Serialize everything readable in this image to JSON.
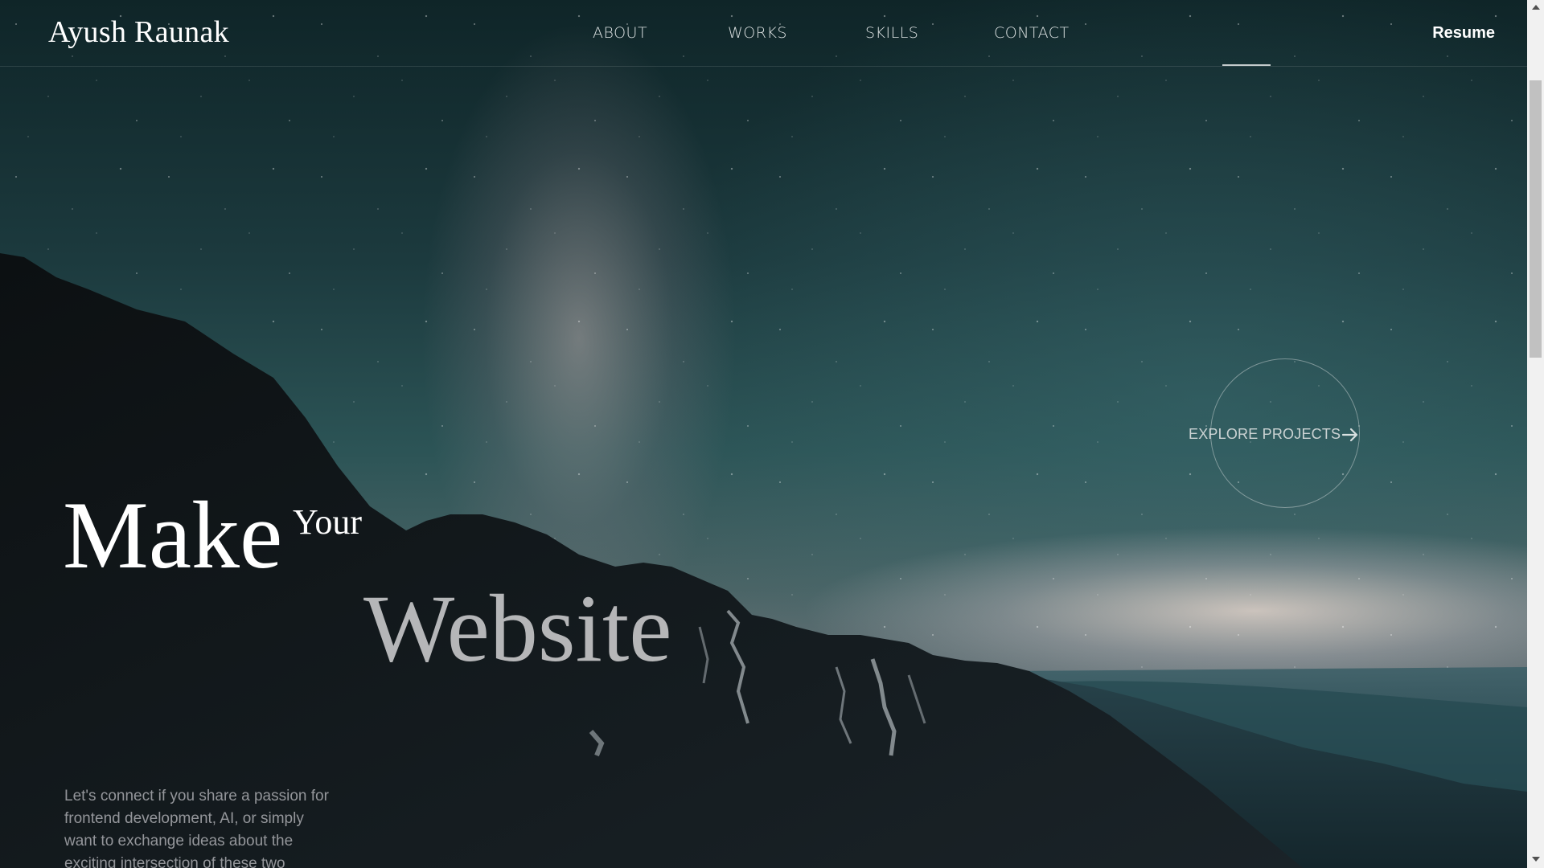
{
  "header": {
    "brand": "Ayush Raunak",
    "nav": [
      "ABOUT",
      "WORKS",
      "SKILLS",
      "CONTACT"
    ],
    "resume": "Resume"
  },
  "hero": {
    "make": "Make",
    "your": "Your",
    "website": "Website",
    "explore": "EXPLORE PROJECTS",
    "intro": "Let's connect if you share a passion for frontend development, AI, or simply want to exchange ideas about the exciting intersection of these two"
  },
  "icons": {
    "explore_arrow": "arrow-right-icon"
  }
}
